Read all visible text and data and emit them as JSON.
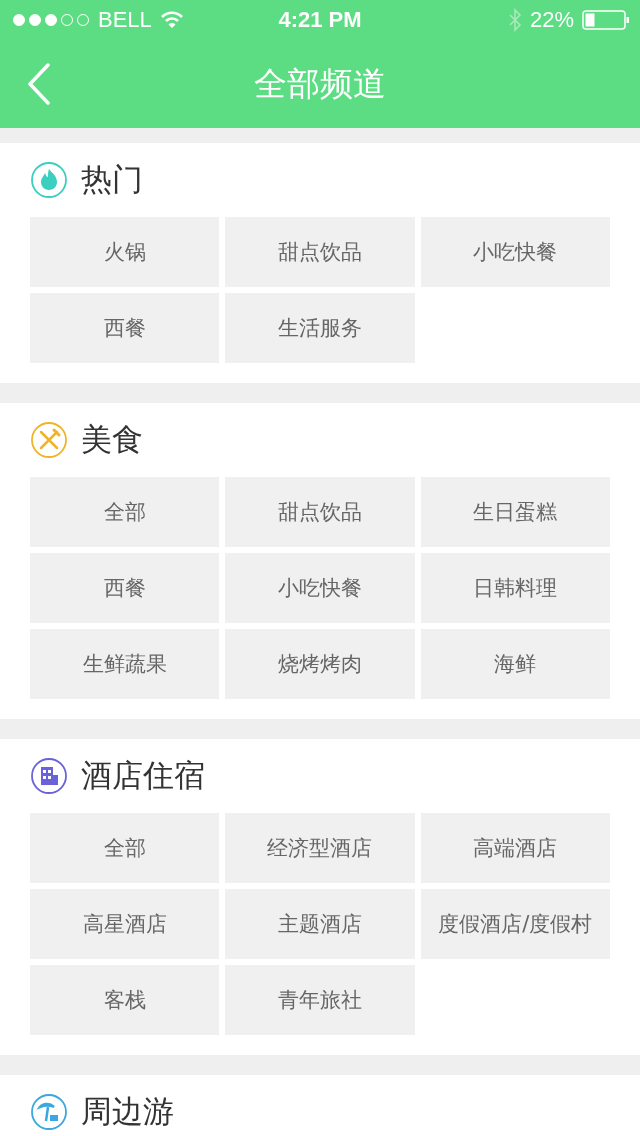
{
  "status_bar": {
    "carrier": "BELL",
    "time": "4:21 PM",
    "battery": "22%"
  },
  "nav_bar": {
    "title": "全部频道"
  },
  "sections": [
    {
      "title": "热门",
      "color": "#3ccfc0",
      "items": [
        "火锅",
        "甜点饮品",
        "小吃快餐",
        "西餐",
        "生活服务"
      ]
    },
    {
      "title": "美食",
      "color": "#f0b428",
      "items": [
        "全部",
        "甜点饮品",
        "生日蛋糕",
        "西餐",
        "小吃快餐",
        "日韩料理",
        "生鲜蔬果",
        "烧烤烤肉",
        "海鲜"
      ]
    },
    {
      "title": "酒店住宿",
      "color": "#6a62d8",
      "items": [
        "全部",
        "经济型酒店",
        "高端酒店",
        "高星酒店",
        "主题酒店",
        "度假酒店/度假村",
        "客栈",
        "青年旅社"
      ]
    },
    {
      "title": "周边游",
      "color": "#3ba7e0"
    }
  ]
}
